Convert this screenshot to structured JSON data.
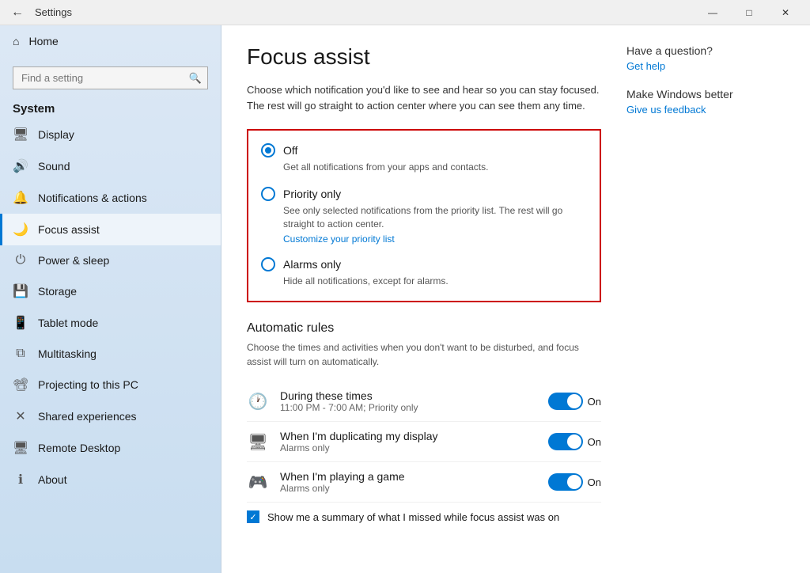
{
  "titlebar": {
    "back_icon": "←",
    "title": "Settings",
    "min_icon": "—",
    "max_icon": "□",
    "close_icon": "✕"
  },
  "sidebar": {
    "search_placeholder": "Find a setting",
    "search_icon": "🔍",
    "home_label": "Home",
    "home_icon": "⌂",
    "system_label": "System",
    "items": [
      {
        "id": "display",
        "icon": "🖥",
        "label": "Display"
      },
      {
        "id": "sound",
        "icon": "🔊",
        "label": "Sound"
      },
      {
        "id": "notifications",
        "icon": "🔔",
        "label": "Notifications & actions"
      },
      {
        "id": "focus",
        "icon": "🌙",
        "label": "Focus assist",
        "active": true
      },
      {
        "id": "power",
        "icon": "⏻",
        "label": "Power & sleep"
      },
      {
        "id": "storage",
        "icon": "💾",
        "label": "Storage"
      },
      {
        "id": "tablet",
        "icon": "📱",
        "label": "Tablet mode"
      },
      {
        "id": "multitasking",
        "icon": "⧉",
        "label": "Multitasking"
      },
      {
        "id": "projecting",
        "icon": "📽",
        "label": "Projecting to this PC"
      },
      {
        "id": "shared",
        "icon": "✕",
        "label": "Shared experiences"
      },
      {
        "id": "remote",
        "icon": "🖥",
        "label": "Remote Desktop"
      },
      {
        "id": "about",
        "icon": "ℹ",
        "label": "About"
      }
    ]
  },
  "page": {
    "title": "Focus assist",
    "description": "Choose which notification you'd like to see and hear so you can stay focused. The rest will go straight to action center where you can see them any time.",
    "options": [
      {
        "id": "off",
        "label": "Off",
        "desc": "Get all notifications from your apps and contacts.",
        "checked": true
      },
      {
        "id": "priority",
        "label": "Priority only",
        "desc": "See only selected notifications from the priority list. The rest will go straight to action center.",
        "link": "Customize your priority list",
        "checked": false
      },
      {
        "id": "alarms",
        "label": "Alarms only",
        "desc": "Hide all notifications, except for alarms.",
        "checked": false
      }
    ],
    "automatic_rules": {
      "title": "Automatic rules",
      "desc": "Choose the times and activities when you don't want to be disturbed, and focus assist will turn on automatically.",
      "rules": [
        {
          "id": "during-times",
          "icon": "🕐",
          "name": "During these times",
          "sub": "11:00 PM - 7:00 AM; Priority only",
          "toggle_on": true
        },
        {
          "id": "duplicating",
          "icon": "🖥",
          "name": "When I'm duplicating my display",
          "sub": "Alarms only",
          "toggle_on": true
        },
        {
          "id": "gaming",
          "icon": "🎮",
          "name": "When I'm playing a game",
          "sub": "Alarms only",
          "toggle_on": true
        }
      ],
      "toggle_label": "On",
      "checkbox_label": "Show me a summary of what I missed while focus assist was on",
      "checkbox_checked": true
    }
  },
  "aside": {
    "question": "Have a question?",
    "get_help": "Get help",
    "windows_better": "Make Windows better",
    "feedback": "Give us feedback"
  }
}
